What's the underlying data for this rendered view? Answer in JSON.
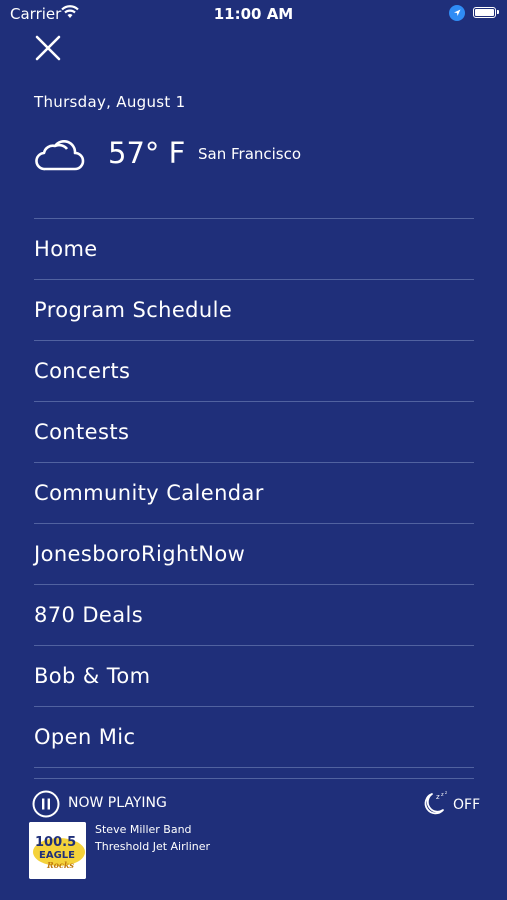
{
  "status_bar": {
    "carrier": "Carrier",
    "time": "11:00 AM"
  },
  "weather": {
    "date": "Thursday, August 1",
    "icon": "cloud-icon",
    "temperature": "57° F",
    "city": "San Francisco"
  },
  "menu": {
    "items": [
      {
        "label": "Home"
      },
      {
        "label": "Program Schedule"
      },
      {
        "label": "Concerts"
      },
      {
        "label": "Contests"
      },
      {
        "label": "Community Calendar"
      },
      {
        "label": "JonesboroRightNow"
      },
      {
        "label": "870 Deals"
      },
      {
        "label": "Bob & Tom"
      },
      {
        "label": "Open Mic"
      }
    ]
  },
  "player": {
    "now_playing_label": "NOW PLAYING",
    "sleep_timer_label": "OFF",
    "logo_text": {
      "line1": "100.5",
      "line2": "EAGLE",
      "line3": "Rocks"
    },
    "artist": "Steve Miller Band",
    "title": "Threshold  Jet Airliner"
  },
  "colors": {
    "background": "#1f2f7a",
    "divider": "#5162a0",
    "text": "#ffffff",
    "location_blue": "#2f8cf5"
  }
}
